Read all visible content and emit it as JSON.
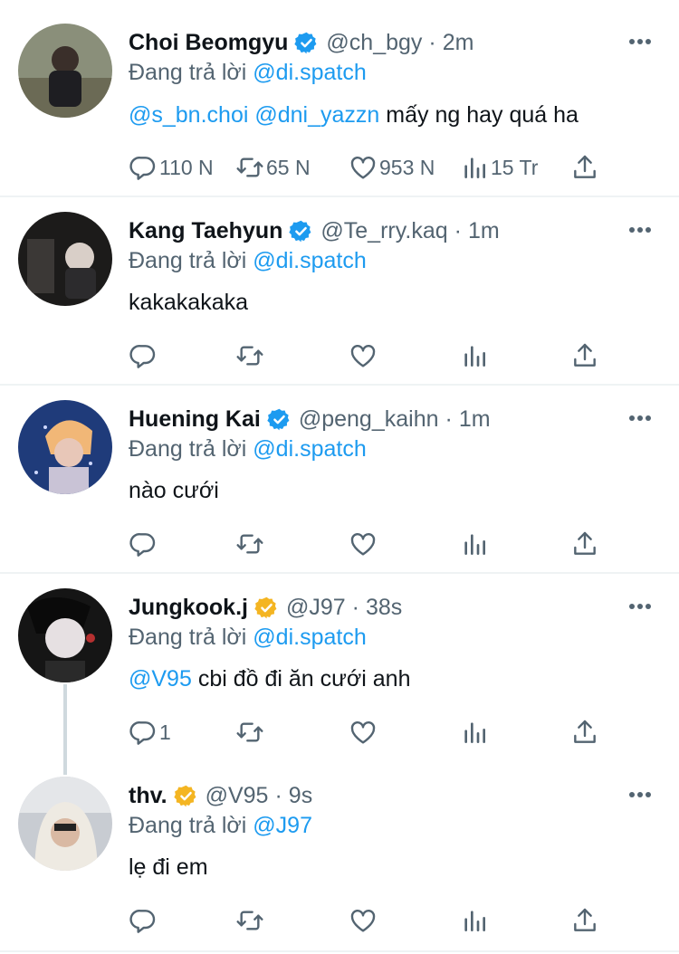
{
  "colors": {
    "accent": "#1d9bf0",
    "muted": "#536471",
    "text": "#0f1419",
    "gold": "#f4b522"
  },
  "tweets": [
    {
      "name": "Choi Beomgyu",
      "badge": "blue-verified-icon",
      "handle": "@ch_bgy",
      "time": "2m",
      "reply_prefix": "Đang trả lời",
      "reply_to": "@di.spatch",
      "mention1": "@s_bn.choi",
      "mention2": "@dni_yazzn",
      "text": "mấy ng hay quá ha",
      "replies": "110 N",
      "retweets": "65 N",
      "likes": "953 N",
      "views": "15 Tr"
    },
    {
      "name": "Kang Taehyun",
      "badge": "blue-verified-icon",
      "handle": "@Te_rry.kaq",
      "time": "1m",
      "reply_prefix": "Đang trả lời",
      "reply_to": "@di.spatch",
      "text": "kakakakaka"
    },
    {
      "name": "Huening Kai",
      "badge": "blue-verified-icon",
      "handle": "@peng_kaihn",
      "time": "1m",
      "reply_prefix": "Đang trả lời",
      "reply_to": "@di.spatch",
      "text": "nào cưới"
    },
    {
      "name": "Jungkook.j",
      "badge": "gold-verified-icon",
      "handle": "@J97",
      "time": "38s",
      "reply_prefix": "Đang trả lời",
      "reply_to": "@di.spatch",
      "mention1": "@V95",
      "text": "cbi đồ đi ăn cưới anh",
      "replies": "1"
    },
    {
      "name": "thv.",
      "badge": "gold-verified-icon",
      "handle": "@V95",
      "time": "9s",
      "reply_prefix": "Đang trả lời",
      "reply_to": "@J97",
      "text": "lẹ đi em"
    }
  ]
}
